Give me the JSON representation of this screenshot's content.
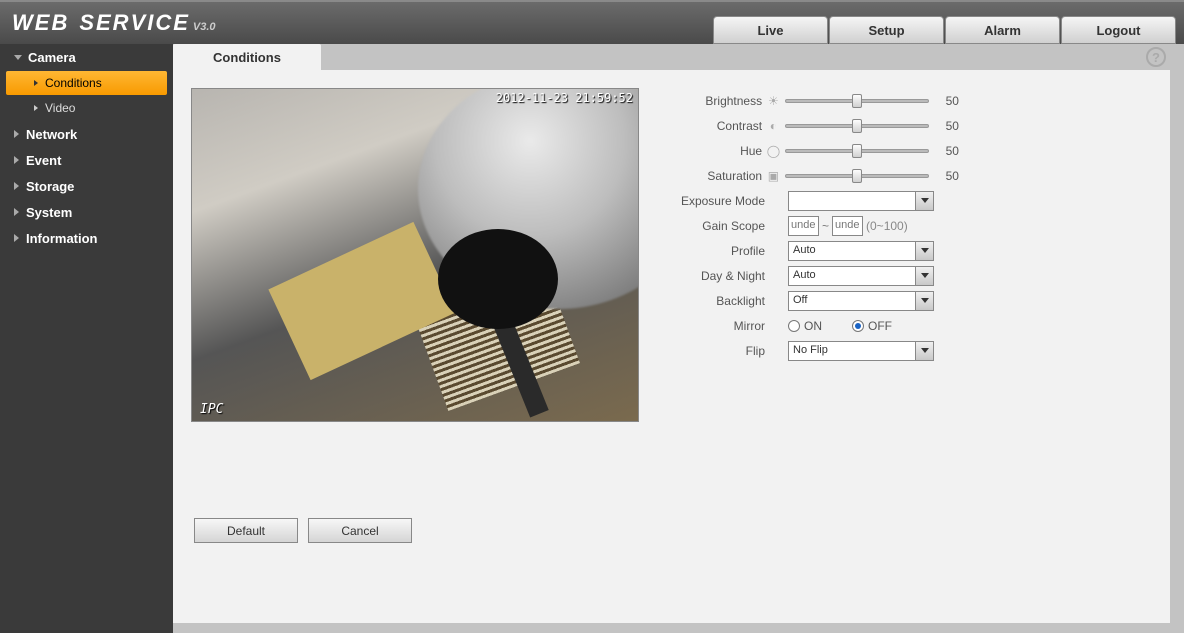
{
  "header": {
    "logo_web": "WEB",
    "logo_service": "SERVICE",
    "logo_version": "V3.0",
    "tabs": {
      "live": "Live",
      "setup": "Setup",
      "alarm": "Alarm",
      "logout": "Logout"
    }
  },
  "sidebar": {
    "camera": "Camera",
    "conditions": "Conditions",
    "video": "Video",
    "network": "Network",
    "event": "Event",
    "storage": "Storage",
    "system": "System",
    "information": "Information"
  },
  "tab": {
    "title": "Conditions"
  },
  "preview": {
    "timestamp": "2012-11-23 21:59:52",
    "label": "IPC"
  },
  "sliders": {
    "brightness": {
      "label": "Brightness",
      "value": "50"
    },
    "contrast": {
      "label": "Contrast",
      "value": "50"
    },
    "hue": {
      "label": "Hue",
      "value": "50"
    },
    "saturation": {
      "label": "Saturation",
      "value": "50"
    }
  },
  "fields": {
    "exposure_mode": {
      "label": "Exposure Mode",
      "value": ""
    },
    "gain_scope": {
      "label": "Gain Scope",
      "from": "unde",
      "sep": "~",
      "to": "unde",
      "hint": "(0~100)"
    },
    "profile": {
      "label": "Profile",
      "value": "Auto"
    },
    "day_night": {
      "label": "Day & Night",
      "value": "Auto"
    },
    "backlight": {
      "label": "Backlight",
      "value": "Off"
    },
    "mirror": {
      "label": "Mirror",
      "on": "ON",
      "off": "OFF"
    },
    "flip": {
      "label": "Flip",
      "value": "No Flip"
    }
  },
  "buttons": {
    "default": "Default",
    "cancel": "Cancel"
  }
}
